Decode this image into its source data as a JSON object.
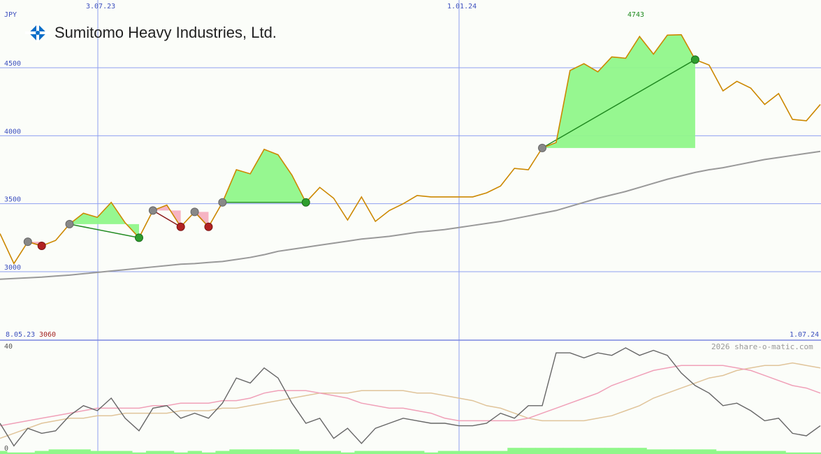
{
  "company_name": "Sumitomo Heavy Industries, Ltd.",
  "logo_icon": "company-logo-icon",
  "currency": "JPY",
  "copyright": "2026 share-o-matic.com",
  "labels": {
    "date_start": "8.05.23",
    "date_end": "1.07.24",
    "low": "3060",
    "high": "4743",
    "osc_top": "40",
    "osc_bottom": "0"
  },
  "colors": {
    "price": "#cc8800",
    "ma": "#999999",
    "gain_fill": "#90f78a",
    "loss_fill": "#f5b0c0",
    "gain_line": "#228b22",
    "loss_line": "#8b1a1a",
    "grid": "#8f9ff0"
  },
  "chart_data": [
    {
      "type": "line",
      "title": "Sumitomo Heavy Industries, Ltd.",
      "ylabel": "JPY",
      "ylim": [
        2950,
        4900
      ],
      "x_tick_labels": [
        "3.07.23",
        "1.01.24"
      ],
      "y_ticks": [
        3000,
        3500,
        4000,
        4500
      ],
      "grid": true,
      "series": [
        {
          "role": "price",
          "values": [
            3280,
            3060,
            3220,
            3190,
            3230,
            3350,
            3430,
            3400,
            3510,
            3360,
            3250,
            3450,
            3490,
            3330,
            3440,
            3330,
            3510,
            3750,
            3720,
            3900,
            3860,
            3710,
            3510,
            3620,
            3540,
            3380,
            3550,
            3370,
            3450,
            3500,
            3560,
            3550,
            3550,
            3550,
            3550,
            3580,
            3630,
            3760,
            3750,
            3910,
            3950,
            4480,
            4530,
            4470,
            4580,
            4570,
            4730,
            4600,
            4740,
            4743,
            4560,
            4520,
            4330,
            4400,
            4350,
            4230,
            4310,
            4120,
            4110,
            4230
          ]
        },
        {
          "role": "moving-average",
          "values": [
            2945,
            2950,
            2955,
            2960,
            2968,
            2975,
            2985,
            2995,
            3005,
            3015,
            3025,
            3035,
            3045,
            3055,
            3060,
            3068,
            3075,
            3090,
            3105,
            3125,
            3150,
            3165,
            3180,
            3195,
            3210,
            3225,
            3240,
            3250,
            3260,
            3275,
            3290,
            3300,
            3310,
            3325,
            3340,
            3355,
            3370,
            3390,
            3410,
            3430,
            3450,
            3480,
            3510,
            3540,
            3565,
            3590,
            3620,
            3650,
            3680,
            3705,
            3730,
            3750,
            3765,
            3785,
            3805,
            3825,
            3840,
            3855,
            3870,
            3885
          ]
        }
      ],
      "signals": [
        {
          "from": 2,
          "to": 3,
          "result": "loss"
        },
        {
          "from": 5,
          "to": 10,
          "result": "gain"
        },
        {
          "from": 11,
          "to": 13,
          "result": "loss"
        },
        {
          "from": 14,
          "to": 15,
          "result": "loss"
        },
        {
          "from": 16,
          "to": 22,
          "result": "gain"
        },
        {
          "from": 39,
          "to": 50,
          "result": "gain"
        }
      ]
    },
    {
      "type": "line",
      "ylim": [
        0,
        40
      ],
      "y_ticks": [
        0,
        40
      ],
      "series": [
        {
          "role": "oscillator",
          "values": [
            10,
            1,
            8,
            6,
            7,
            13,
            17,
            15,
            20,
            12,
            7,
            16,
            17,
            12,
            14,
            12,
            18,
            28,
            26,
            32,
            28,
            18,
            10,
            12,
            4,
            8,
            2,
            8,
            10,
            12,
            11,
            10,
            10,
            9,
            9,
            10,
            14,
            12,
            17,
            17,
            38,
            38,
            36,
            38,
            37,
            40,
            37,
            39,
            37,
            30,
            25,
            22,
            17,
            18,
            15,
            11,
            12,
            6,
            5,
            9
          ]
        },
        {
          "role": "oscillator-average",
          "values": [
            9,
            10,
            11,
            12,
            13,
            14,
            15,
            16,
            16,
            16,
            16,
            17,
            17,
            18,
            18,
            18,
            19,
            19,
            20,
            22,
            23,
            23,
            23,
            22,
            21,
            20,
            18,
            17,
            16,
            16,
            15,
            14,
            12,
            11,
            11,
            11,
            11,
            11,
            12,
            14,
            16,
            18,
            20,
            22,
            25,
            27,
            29,
            31,
            32,
            33,
            33,
            33,
            33,
            32,
            31,
            29,
            27,
            25,
            24,
            22
          ]
        },
        {
          "role": "oscillator-slow-average",
          "values": [
            4,
            6,
            8,
            10,
            11,
            12,
            12,
            13,
            13,
            14,
            14,
            14,
            14,
            15,
            15,
            15,
            16,
            16,
            17,
            18,
            19,
            20,
            21,
            22,
            22,
            22,
            23,
            23,
            23,
            23,
            22,
            22,
            21,
            20,
            19,
            17,
            16,
            14,
            12,
            11,
            11,
            11,
            11,
            12,
            13,
            15,
            17,
            20,
            22,
            24,
            26,
            28,
            29,
            31,
            32,
            33,
            33,
            34,
            33,
            32
          ]
        },
        {
          "role": "volume",
          "values": [
            2,
            1,
            1,
            2,
            3,
            3,
            3,
            2,
            2,
            2,
            1,
            2,
            2,
            1,
            2,
            1,
            2,
            3,
            3,
            3,
            3,
            3,
            2,
            2,
            2,
            1,
            2,
            2,
            2,
            2,
            2,
            1,
            2,
            2,
            2,
            2,
            2,
            4,
            4,
            4,
            4,
            4,
            4,
            4,
            4,
            4,
            4,
            3,
            3,
            3,
            3,
            3,
            2,
            2,
            2,
            2,
            2,
            1,
            1,
            1
          ]
        }
      ]
    }
  ]
}
